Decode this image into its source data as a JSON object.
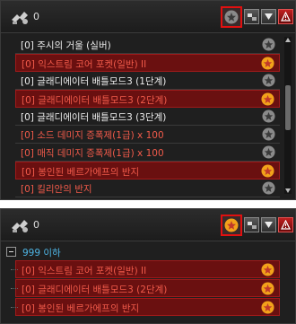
{
  "top_panel": {
    "count": "0",
    "rows": [
      {
        "text": "[0] 주시의 거울 (실버)",
        "color": "white",
        "highlight": false,
        "fav": false
      },
      {
        "text": "[0] 익스트림 코어 포켓(일반) II",
        "color": "red",
        "highlight": true,
        "fav": true
      },
      {
        "text": "[0] 글래디에이터 배틀모드3 (1단계)",
        "color": "white",
        "highlight": false,
        "fav": false
      },
      {
        "text": "[0] 글래디에이터 배틀모드3 (2단계)",
        "color": "red",
        "highlight": true,
        "fav": true
      },
      {
        "text": "[0] 글래디에이터 배틀모드3 (3단계)",
        "color": "white",
        "highlight": false,
        "fav": false
      },
      {
        "text": "[0] 소드 데미지 증폭제(1급) x 100",
        "color": "red",
        "highlight": false,
        "fav": false
      },
      {
        "text": "[0] 매직 데미지 증폭제(1급) x 100",
        "color": "red",
        "highlight": false,
        "fav": false
      },
      {
        "text": "[0] 봉인된 베르가에프의 반지",
        "color": "red",
        "highlight": true,
        "fav": true
      },
      {
        "text": "[0] 킬리안의 반지",
        "color": "red",
        "highlight": false,
        "fav": false
      }
    ]
  },
  "bottom_panel": {
    "count": "0",
    "group_label": "999 이하",
    "rows": [
      {
        "text": "[0] 익스트림 코어 포켓(일반) II",
        "color": "red",
        "highlight": true,
        "fav": true
      },
      {
        "text": "[0] 글래디에이터 배틀모드3 (2단계)",
        "color": "red",
        "highlight": true,
        "fav": true
      },
      {
        "text": "[0] 봉인된 베르가에프의 반지",
        "color": "red",
        "highlight": true,
        "fav": true
      }
    ]
  },
  "icons": {
    "main": "item-bundle-icon",
    "favorite_filter": "star-filter-icon",
    "sort": "swap-icon",
    "dropdown": "triangle-down-icon",
    "alert": "warning-icon"
  },
  "colors": {
    "accent_red": "#e01010",
    "star_on": "#f2a21a",
    "star_off": "#8a8a8a",
    "group_blue": "#4fb6e6"
  }
}
